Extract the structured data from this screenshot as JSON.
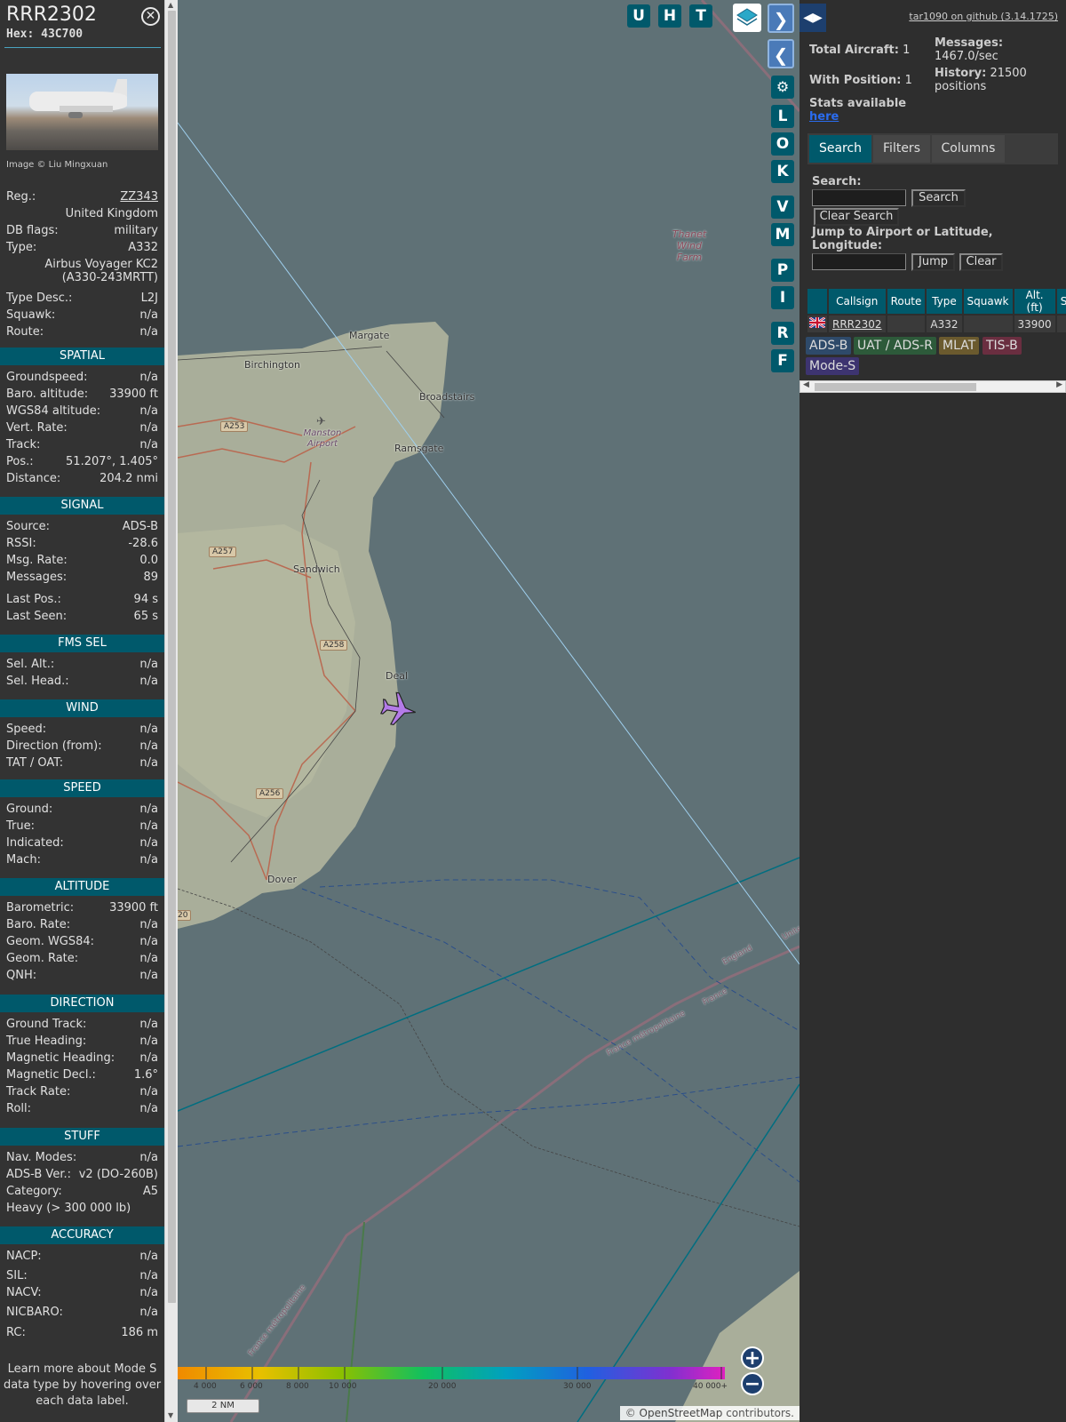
{
  "aircraft": {
    "callsign": "RRR2302",
    "hex_label": "Hex: 43C700",
    "image_credit": "Image © Liu Mingxuan",
    "info": [
      {
        "k": "Reg.:",
        "v": "ZZ343"
      },
      {
        "k": "",
        "v": "United Kingdom"
      },
      {
        "k": "DB flags:",
        "v": "military"
      },
      {
        "k": "Type:",
        "v": "A332"
      },
      {
        "k": "",
        "v": "Airbus Voyager KC2 (A330-243MRTT)"
      },
      {
        "k": "Type Desc.:",
        "v": "L2J"
      },
      {
        "k": "Squawk:",
        "v": "n/a"
      },
      {
        "k": "Route:",
        "v": "n/a"
      }
    ]
  },
  "sections": {
    "spatial": {
      "title": "SPATIAL",
      "rows": [
        {
          "k": "Groundspeed:",
          "v": "n/a"
        },
        {
          "k": "Baro. altitude:",
          "v": "33900 ft"
        },
        {
          "k": "WGS84 altitude:",
          "v": "n/a"
        },
        {
          "k": "Vert. Rate:",
          "v": "n/a"
        },
        {
          "k": "Track:",
          "v": "n/a"
        },
        {
          "k": "Pos.:",
          "v": "51.207°, 1.405°"
        },
        {
          "k": "Distance:",
          "v": "204.2 nmi"
        }
      ]
    },
    "signal": {
      "title": "SIGNAL",
      "rows": [
        {
          "k": "Source:",
          "v": "ADS-B"
        },
        {
          "k": "RSSI:",
          "v": "-28.6"
        },
        {
          "k": "Msg. Rate:",
          "v": "0.0"
        },
        {
          "k": "Messages:",
          "v": "89"
        },
        {
          "k": "Last Pos.:",
          "v": "94 s"
        },
        {
          "k": "Last Seen:",
          "v": "65 s"
        }
      ]
    },
    "fms": {
      "title": "FMS SEL",
      "rows": [
        {
          "k": "Sel. Alt.:",
          "v": "n/a"
        },
        {
          "k": "Sel. Head.:",
          "v": "n/a"
        }
      ]
    },
    "wind": {
      "title": "WIND",
      "rows": [
        {
          "k": "Speed:",
          "v": "n/a"
        },
        {
          "k": "Direction (from):",
          "v": "n/a"
        },
        {
          "k": "TAT / OAT:",
          "v": "n/a"
        }
      ]
    },
    "speed": {
      "title": "SPEED",
      "rows": [
        {
          "k": "Ground:",
          "v": "n/a"
        },
        {
          "k": "True:",
          "v": "n/a"
        },
        {
          "k": "Indicated:",
          "v": "n/a"
        },
        {
          "k": "Mach:",
          "v": "n/a"
        }
      ]
    },
    "altitude": {
      "title": "ALTITUDE",
      "rows": [
        {
          "k": "Barometric:",
          "v": "33900 ft"
        },
        {
          "k": "Baro. Rate:",
          "v": "n/a"
        },
        {
          "k": "Geom. WGS84:",
          "v": "n/a"
        },
        {
          "k": "Geom. Rate:",
          "v": "n/a"
        },
        {
          "k": "QNH:",
          "v": "n/a"
        }
      ]
    },
    "direction": {
      "title": "DIRECTION",
      "rows": [
        {
          "k": "Ground Track:",
          "v": "n/a"
        },
        {
          "k": "True Heading:",
          "v": "n/a"
        },
        {
          "k": "Magnetic Heading:",
          "v": "n/a"
        },
        {
          "k": "Magnetic Decl.:",
          "v": "1.6°"
        },
        {
          "k": "Track Rate:",
          "v": "n/a"
        },
        {
          "k": "Roll:",
          "v": "n/a"
        }
      ]
    },
    "stuff": {
      "title": "STUFF",
      "rows": [
        {
          "k": "Nav. Modes:",
          "v": "n/a"
        },
        {
          "k": "ADS-B Ver.:",
          "v": "v2 (DO-260B)"
        },
        {
          "k": "Category:",
          "v": "A5"
        },
        {
          "k": "Heavy (> 300 000 lb)",
          "v": ""
        }
      ]
    },
    "accuracy": {
      "title": "ACCURACY",
      "rows": [
        {
          "k": "NACP:",
          "v": "n/a"
        },
        {
          "k": "SIL:",
          "v": "n/a"
        },
        {
          "k": "NACV:",
          "v": "n/a"
        },
        {
          "k": "NICBARO:",
          "v": "n/a"
        },
        {
          "k": "RC:",
          "v": "186 m"
        }
      ]
    }
  },
  "footer_note": "Learn more about Mode S data type by hovering over each data label.",
  "map": {
    "top_buttons": [
      "U",
      "H",
      "T"
    ],
    "side_buttons": [
      "L",
      "O",
      "K",
      "V",
      "M",
      "P",
      "I",
      "R",
      "F"
    ],
    "labels": {
      "wind_farm": "Thanet Wind Farm",
      "margate": "Margate",
      "birchington": "Birchington",
      "broadstairs": "Broadstairs",
      "manston": "Manston Airport",
      "ramsgate": "Ramsgate",
      "sandwich": "Sandwich",
      "deal": "Deal",
      "dover": "Dover",
      "a253": "A253",
      "a257": "A257",
      "a258": "A258",
      "a256": "A256",
      "england": "England",
      "france1": "France",
      "france_metro1": "France métropolitaine",
      "france_metro2": "France métropolitaine",
      "united": "Unite",
      "a20": "20"
    },
    "legend_ticks": [
      "4 000",
      "6 000",
      "8 000",
      "10 000",
      "20 000",
      "30 000",
      "40 000+"
    ],
    "scale": "2 NM",
    "attribution_pre": "© ",
    "attribution_link": "OpenStreetMap",
    "attribution_post": " contributors."
  },
  "panel": {
    "github": "tar1090 on github (3.14.1725)",
    "total_aircraft_label": "Total Aircraft:",
    "total_aircraft": "1",
    "with_position_label": "With Position:",
    "with_position": "1",
    "messages_label": "Messages:",
    "messages_value": "1467.0/sec",
    "history_label": "History:",
    "history_value": "21500",
    "history_unit": "positions",
    "stats_label": "Stats available",
    "stats_link": "here",
    "tabs": [
      "Search",
      "Filters",
      "Columns"
    ],
    "search_label": "Search:",
    "search_button": "Search",
    "clear_search_button": "Clear Search",
    "jump_label": "Jump to Airport or Latitude, Longitude:",
    "jump_button": "Jump",
    "clear_button": "Clear",
    "table": {
      "columns": [
        "",
        "Callsign",
        "Route",
        "Type",
        "Squawk",
        "Alt. (ft)",
        "Spd"
      ],
      "rows": [
        [
          "",
          "RRR2302",
          "",
          "A332",
          "",
          "33900",
          ""
        ]
      ]
    },
    "sources": [
      "ADS-B",
      "UAT / ADS-R",
      "MLAT",
      "TIS-B",
      "Mode-S"
    ]
  }
}
